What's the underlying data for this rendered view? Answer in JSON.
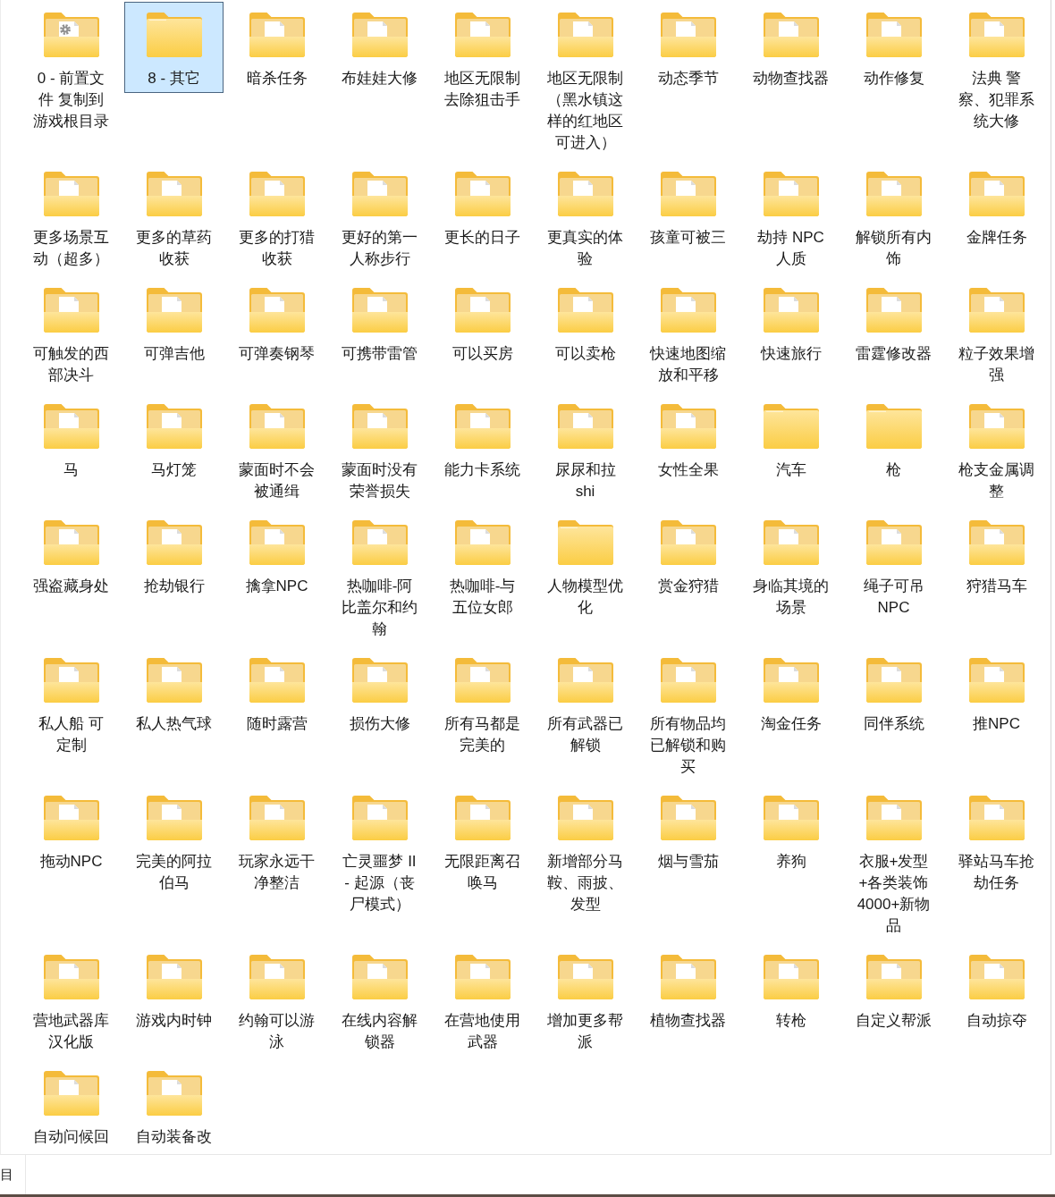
{
  "items": [
    {
      "name": "0 - 前置文件 复制到游戏根目录",
      "kind": "gear",
      "selected": false
    },
    {
      "name": "8 - 其它",
      "kind": "empty",
      "selected": true
    },
    {
      "name": "暗杀任务",
      "kind": "documents",
      "selected": false
    },
    {
      "name": "布娃娃大修",
      "kind": "documents",
      "selected": false
    },
    {
      "name": "地区无限制去除狙击手",
      "kind": "documents",
      "selected": false
    },
    {
      "name": "地区无限制（黑水镇这样的红地区可进入）",
      "kind": "documents",
      "selected": false
    },
    {
      "name": "动态季节",
      "kind": "documents",
      "selected": false
    },
    {
      "name": "动物查找器",
      "kind": "documents",
      "selected": false
    },
    {
      "name": "动作修复",
      "kind": "documents",
      "selected": false
    },
    {
      "name": "法典 警察、犯罪系统大修",
      "kind": "documents",
      "selected": false
    },
    {
      "name": "更多场景互动（超多）",
      "kind": "documents",
      "selected": false
    },
    {
      "name": "更多的草药收获",
      "kind": "documents",
      "selected": false
    },
    {
      "name": "更多的打猎收获",
      "kind": "documents",
      "selected": false
    },
    {
      "name": "更好的第一人称步行",
      "kind": "documents",
      "selected": false
    },
    {
      "name": "更长的日子",
      "kind": "documents",
      "selected": false
    },
    {
      "name": "更真实的体验",
      "kind": "documents",
      "selected": false
    },
    {
      "name": "孩童可被三",
      "kind": "documents",
      "selected": false
    },
    {
      "name": "劫持 NPC 人质",
      "kind": "documents",
      "selected": false
    },
    {
      "name": "解锁所有内饰",
      "kind": "documents",
      "selected": false
    },
    {
      "name": "金牌任务",
      "kind": "documents",
      "selected": false
    },
    {
      "name": "可触发的西部决斗",
      "kind": "documents",
      "selected": false
    },
    {
      "name": "可弹吉他",
      "kind": "documents",
      "selected": false
    },
    {
      "name": "可弹奏钢琴",
      "kind": "documents",
      "selected": false
    },
    {
      "name": "可携带雷管",
      "kind": "documents",
      "selected": false
    },
    {
      "name": "可以买房",
      "kind": "documents",
      "selected": false
    },
    {
      "name": "可以卖枪",
      "kind": "documents",
      "selected": false
    },
    {
      "name": "快速地图缩放和平移",
      "kind": "documents",
      "selected": false
    },
    {
      "name": "快速旅行",
      "kind": "documents",
      "selected": false
    },
    {
      "name": "雷霆修改器",
      "kind": "documents",
      "selected": false
    },
    {
      "name": "粒子效果增强",
      "kind": "documents",
      "selected": false
    },
    {
      "name": "马",
      "kind": "documents",
      "selected": false
    },
    {
      "name": "马灯笼",
      "kind": "documents",
      "selected": false
    },
    {
      "name": "蒙面时不会被通缉",
      "kind": "documents",
      "selected": false
    },
    {
      "name": "蒙面时没有荣誉损失",
      "kind": "documents",
      "selected": false
    },
    {
      "name": "能力卡系统",
      "kind": "documents",
      "selected": false
    },
    {
      "name": "尿尿和拉shi",
      "kind": "documents",
      "selected": false
    },
    {
      "name": "女性全果",
      "kind": "documents",
      "selected": false
    },
    {
      "name": "汽车",
      "kind": "empty",
      "selected": false
    },
    {
      "name": "枪",
      "kind": "empty",
      "selected": false
    },
    {
      "name": "枪支金属调整",
      "kind": "documents",
      "selected": false
    },
    {
      "name": "强盗藏身处",
      "kind": "documents",
      "selected": false
    },
    {
      "name": "抢劫银行",
      "kind": "documents",
      "selected": false
    },
    {
      "name": "擒拿NPC",
      "kind": "documents",
      "selected": false
    },
    {
      "name": "热咖啡-阿比盖尔和约翰",
      "kind": "documents",
      "selected": false
    },
    {
      "name": "热咖啡-与五位女郎",
      "kind": "documents",
      "selected": false
    },
    {
      "name": "人物模型优化",
      "kind": "empty",
      "selected": false
    },
    {
      "name": "赏金狩猎",
      "kind": "documents",
      "selected": false
    },
    {
      "name": "身临其境的场景",
      "kind": "documents",
      "selected": false
    },
    {
      "name": "绳子可吊 NPC",
      "kind": "documents",
      "selected": false
    },
    {
      "name": "狩猎马车",
      "kind": "documents",
      "selected": false
    },
    {
      "name": "私人船 可定制",
      "kind": "documents",
      "selected": false
    },
    {
      "name": "私人热气球",
      "kind": "documents",
      "selected": false
    },
    {
      "name": "随时露营",
      "kind": "documents",
      "selected": false
    },
    {
      "name": "损伤大修",
      "kind": "documents",
      "selected": false
    },
    {
      "name": "所有马都是完美的",
      "kind": "documents",
      "selected": false
    },
    {
      "name": "所有武器已解锁",
      "kind": "documents",
      "selected": false
    },
    {
      "name": "所有物品均已解锁和购买",
      "kind": "documents",
      "selected": false
    },
    {
      "name": "淘金任务",
      "kind": "documents",
      "selected": false
    },
    {
      "name": "同伴系统",
      "kind": "documents",
      "selected": false
    },
    {
      "name": "推NPC",
      "kind": "documents",
      "selected": false
    },
    {
      "name": "拖动NPC",
      "kind": "documents",
      "selected": false
    },
    {
      "name": "完美的阿拉伯马",
      "kind": "documents",
      "selected": false
    },
    {
      "name": "玩家永远干净整洁",
      "kind": "documents",
      "selected": false
    },
    {
      "name": "亡灵噩梦 II - 起源（丧尸模式）",
      "kind": "documents",
      "selected": false
    },
    {
      "name": "无限距离召唤马",
      "kind": "documents",
      "selected": false
    },
    {
      "name": "新增部分马鞍、雨披、发型",
      "kind": "documents",
      "selected": false
    },
    {
      "name": "烟与雪茄",
      "kind": "documents",
      "selected": false
    },
    {
      "name": "养狗",
      "kind": "documents",
      "selected": false
    },
    {
      "name": "衣服+发型+各类装饰4000+新物品",
      "kind": "documents",
      "selected": false
    },
    {
      "name": "驿站马车抢劫任务",
      "kind": "documents",
      "selected": false
    },
    {
      "name": "营地武器库汉化版",
      "kind": "documents",
      "selected": false
    },
    {
      "name": "游戏内时钟",
      "kind": "documents",
      "selected": false
    },
    {
      "name": "约翰可以游泳",
      "kind": "documents",
      "selected": false
    },
    {
      "name": "在线内容解锁器",
      "kind": "documents",
      "selected": false
    },
    {
      "name": "在营地使用武器",
      "kind": "documents",
      "selected": false
    },
    {
      "name": "增加更多帮派",
      "kind": "documents",
      "selected": false
    },
    {
      "name": "植物查找器",
      "kind": "documents",
      "selected": false
    },
    {
      "name": "转枪",
      "kind": "documents",
      "selected": false
    },
    {
      "name": "自定义帮派",
      "kind": "documents",
      "selected": false
    },
    {
      "name": "自动掠夺",
      "kind": "documents",
      "selected": false
    },
    {
      "name": "自动问候回",
      "kind": "documents",
      "selected": false
    },
    {
      "name": "自动装备改",
      "kind": "documents",
      "selected": false
    }
  ],
  "status_bar": {
    "text": "目"
  }
}
